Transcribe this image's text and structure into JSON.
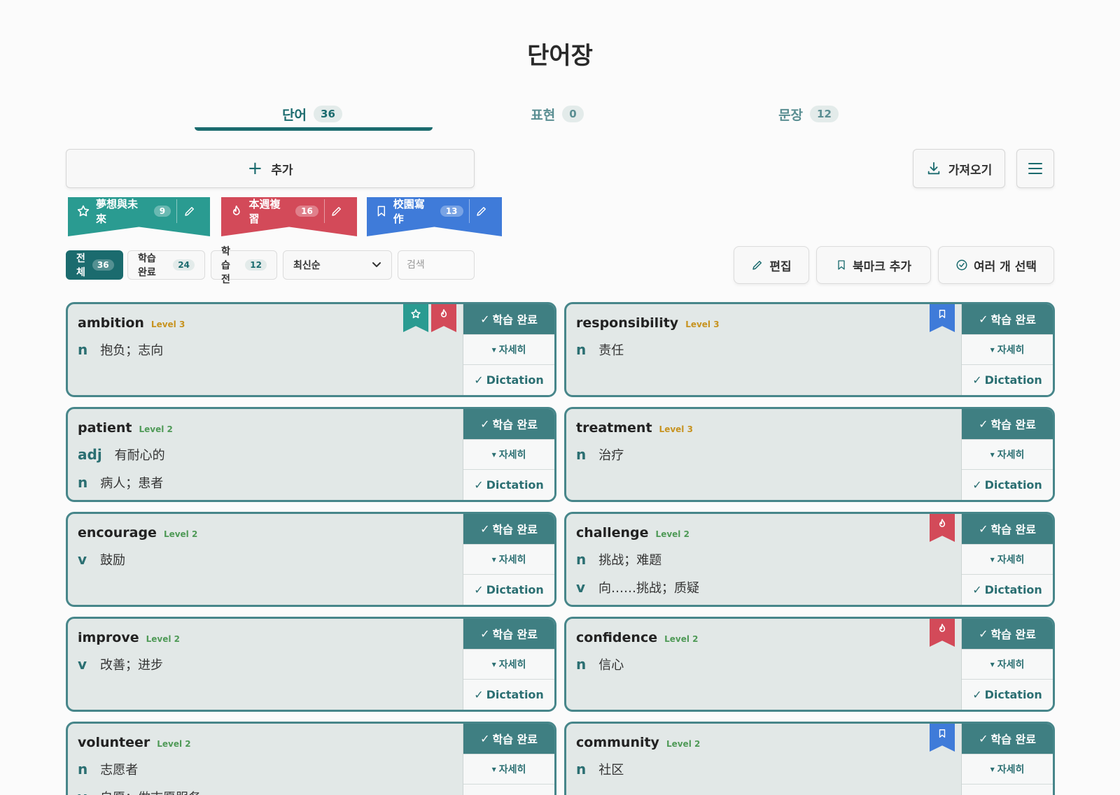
{
  "page": {
    "title": "단어장"
  },
  "tabs": [
    {
      "label": "단어",
      "count": "36"
    },
    {
      "label": "표현",
      "count": "0"
    },
    {
      "label": "문장",
      "count": "12"
    }
  ],
  "toolbar": {
    "add_label": "추가",
    "import_label": "가져오기"
  },
  "folders": [
    {
      "label": "夢想與未來",
      "count": "9",
      "icon": "star-icon",
      "color": "#2a9b91"
    },
    {
      "label": "本週複習",
      "count": "16",
      "icon": "fire-icon",
      "color": "#d34a59"
    },
    {
      "label": "校園寫作",
      "count": "13",
      "icon": "bookmark-icon",
      "color": "#3f7bd9"
    }
  ],
  "filters": {
    "all_label": "전체",
    "all_count": "36",
    "done_label": "학습 완료",
    "done_count": "24",
    "todo_label": "학습 전",
    "todo_count": "12",
    "sort_value": "최신순",
    "search_placeholder": "검색"
  },
  "actions": {
    "edit_label": "편집",
    "bookmark_label": "북마크 추가",
    "multi_label": "여러 개 선택"
  },
  "card_buttons": {
    "done_label": "학습 완료",
    "detail_label": "자세히",
    "dictation_label": "Dictation"
  },
  "cards": [
    {
      "word": "ambition",
      "level": "Level 3",
      "defs": [
        {
          "pos": "n",
          "text": "抱负；志向"
        }
      ],
      "ribbons": [
        "teal",
        "red"
      ]
    },
    {
      "word": "responsibility",
      "level": "Level 3",
      "defs": [
        {
          "pos": "n",
          "text": "责任"
        }
      ],
      "ribbons": [
        "blue"
      ]
    },
    {
      "word": "patient",
      "level": "Level 2",
      "defs": [
        {
          "pos": "adj",
          "text": "有耐心的"
        },
        {
          "pos": "n",
          "text": "病人；患者"
        }
      ],
      "ribbons": []
    },
    {
      "word": "treatment",
      "level": "Level 3",
      "defs": [
        {
          "pos": "n",
          "text": "治疗"
        }
      ],
      "ribbons": []
    },
    {
      "word": "encourage",
      "level": "Level 2",
      "defs": [
        {
          "pos": "v",
          "text": "鼓励"
        }
      ],
      "ribbons": []
    },
    {
      "word": "challenge",
      "level": "Level 2",
      "defs": [
        {
          "pos": "n",
          "text": "挑战；难题"
        },
        {
          "pos": "v",
          "text": "向……挑战；质疑"
        }
      ],
      "ribbons": [
        "red"
      ]
    },
    {
      "word": "improve",
      "level": "Level 2",
      "defs": [
        {
          "pos": "v",
          "text": "改善；进步"
        }
      ],
      "ribbons": []
    },
    {
      "word": "confidence",
      "level": "Level 2",
      "defs": [
        {
          "pos": "n",
          "text": "信心"
        }
      ],
      "ribbons": [
        "red"
      ]
    },
    {
      "word": "volunteer",
      "level": "Level 2",
      "defs": [
        {
          "pos": "n",
          "text": "志愿者"
        },
        {
          "pos": "v",
          "text": "自愿；做志愿服务"
        }
      ],
      "ribbons": []
    },
    {
      "word": "community",
      "level": "Level 2",
      "defs": [
        {
          "pos": "n",
          "text": "社区"
        }
      ],
      "ribbons": [
        "blue"
      ]
    }
  ]
}
